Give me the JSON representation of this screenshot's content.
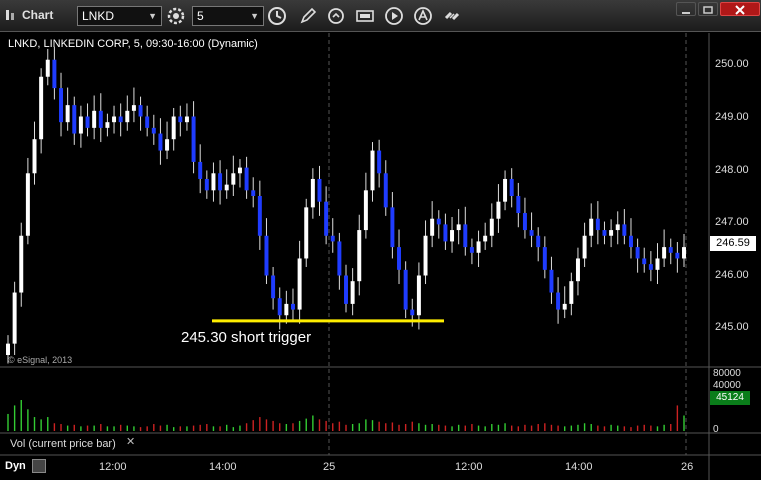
{
  "app": {
    "title": "Chart"
  },
  "toolbar": {
    "symbol": "LNKD",
    "interval": "5",
    "icons": [
      "settings-wheel-icon",
      "clock-icon",
      "pencil-icon",
      "refresh-icon",
      "quote-icon",
      "play-icon",
      "alert-icon",
      "link-icon"
    ]
  },
  "chart": {
    "header": "LNKD, LINKEDIN CORP, 5, 09:30-16:00 (Dynamic)",
    "copyright": "© eSignal, 2013",
    "annotation": "245.30 short trigger",
    "last_price": "246.59",
    "price_axis": [
      "250.00",
      "249.00",
      "248.00",
      "247.00",
      "246.00",
      "245.00"
    ],
    "time_axis": [
      "12:00",
      "14:00",
      "25",
      "12:00",
      "14:00",
      "26"
    ],
    "volume_panel": {
      "label": "Vol (current price bar)",
      "axis": [
        "80000",
        "40000",
        "0"
      ],
      "last_volume": "45124"
    },
    "footer": {
      "label": "Dyn"
    },
    "colors": {
      "up": "#ffffff",
      "down": "#1f3cff",
      "trigger_line": "#ffee00",
      "vol_up": "#33cc33",
      "vol_down": "#cc2222"
    }
  },
  "chart_data": {
    "type": "candlestick",
    "price_range": [
      244.7,
      250.3
    ],
    "trigger_level": 245.3,
    "closes": [
      244.9,
      245.8,
      246.8,
      247.9,
      248.5,
      249.6,
      249.9,
      249.4,
      248.8,
      249.1,
      248.6,
      248.9,
      248.7,
      249.0,
      248.7,
      248.8,
      248.9,
      248.8,
      249.0,
      249.1,
      248.9,
      248.7,
      248.6,
      248.3,
      248.5,
      248.9,
      248.8,
      248.9,
      248.1,
      247.8,
      247.6,
      247.9,
      247.6,
      247.7,
      247.9,
      248.0,
      247.6,
      247.5,
      246.8,
      246.1,
      245.7,
      245.4,
      245.6,
      245.5,
      246.4,
      247.3,
      247.8,
      247.4,
      246.8,
      246.7,
      246.1,
      245.6,
      246.0,
      246.9,
      247.6,
      248.3,
      247.9,
      247.3,
      246.6,
      246.2,
      245.5,
      245.4,
      246.1,
      246.8,
      247.1,
      247.0,
      246.7,
      246.9,
      247.0,
      246.6,
      246.5,
      246.7,
      246.8,
      247.1,
      247.4,
      247.8,
      247.5,
      247.2,
      246.9,
      246.8,
      246.6,
      246.2,
      245.8,
      245.5,
      245.6,
      246.0,
      246.4,
      246.8,
      247.1,
      246.9,
      246.8,
      246.9,
      247.0,
      246.8,
      246.6,
      246.4,
      246.3,
      246.2,
      246.4,
      246.6,
      246.5,
      246.4,
      246.6
    ],
    "volumes": [
      22,
      33,
      40,
      28,
      18,
      15,
      18,
      10,
      9,
      7,
      8,
      6,
      7,
      7,
      9,
      6,
      6,
      8,
      7,
      6,
      5,
      6,
      9,
      7,
      8,
      5,
      6,
      6,
      7,
      8,
      9,
      6,
      6,
      8,
      5,
      7,
      10,
      14,
      18,
      15,
      13,
      10,
      9,
      10,
      13,
      16,
      20,
      15,
      13,
      10,
      12,
      8,
      9,
      10,
      15,
      14,
      12,
      10,
      11,
      8,
      9,
      12,
      10,
      8,
      9,
      8,
      7,
      6,
      8,
      7,
      9,
      7,
      6,
      9,
      8,
      10,
      7,
      6,
      8,
      7,
      9,
      10,
      8,
      7,
      6,
      7,
      8,
      10,
      9,
      7,
      6,
      8,
      7,
      6,
      5,
      7,
      8,
      7,
      6,
      8,
      9,
      33,
      20
    ]
  }
}
